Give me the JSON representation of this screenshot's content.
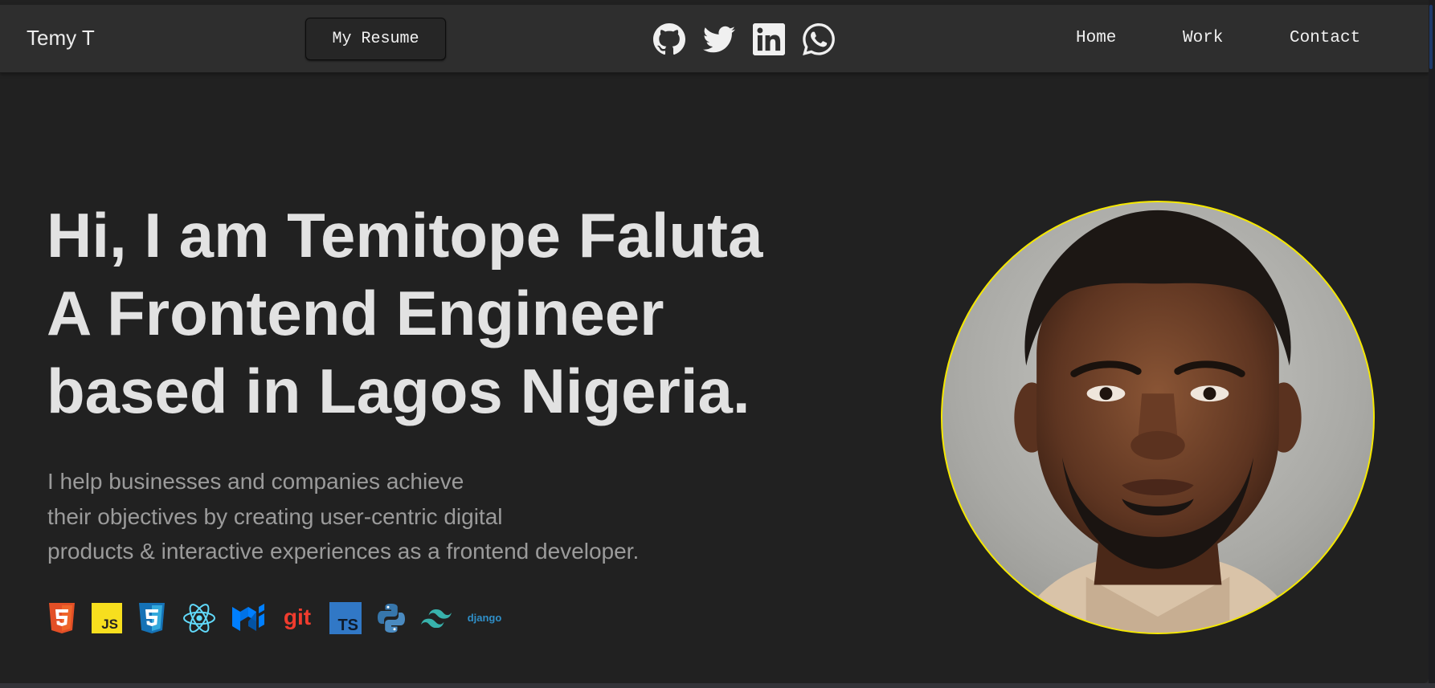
{
  "navbar": {
    "brand": "Temy T",
    "resume_label": "My Resume",
    "socials": [
      {
        "icon": "github-icon"
      },
      {
        "icon": "twitter-icon"
      },
      {
        "icon": "linkedin-icon"
      },
      {
        "icon": "whatsapp-icon"
      }
    ],
    "links": [
      "Home",
      "Work",
      "Contact"
    ]
  },
  "hero": {
    "title_lines": [
      "Hi, I am Temitope Faluta",
      "A Frontend Engineer",
      "based in Lagos Nigeria."
    ],
    "description_lines": [
      "I help businesses and companies achieve",
      "their objectives by creating user-centric digital",
      "products & interactive experiences as a frontend developer."
    ],
    "tech_icons": [
      {
        "icon": "html5-icon",
        "color": "#e34f26"
      },
      {
        "icon": "javascript-icon",
        "color": "#f7df1e",
        "text": "JS"
      },
      {
        "icon": "css3-icon",
        "color": "#1572b6"
      },
      {
        "icon": "react-icon",
        "color": "#61dafb"
      },
      {
        "icon": "mui-icon",
        "color": "#007fff"
      },
      {
        "icon": "git-icon",
        "color": "#f03c2e",
        "text": "git"
      },
      {
        "icon": "typescript-icon",
        "color": "#3178c6",
        "text": "TS"
      },
      {
        "icon": "python-icon",
        "color": "#3776ab"
      },
      {
        "icon": "tailwind-icon",
        "color": "#38b2ac"
      },
      {
        "icon": "django-icon",
        "color": "#2f8fc8",
        "text": "django"
      }
    ],
    "portrait_border_color": "#f5e800"
  }
}
